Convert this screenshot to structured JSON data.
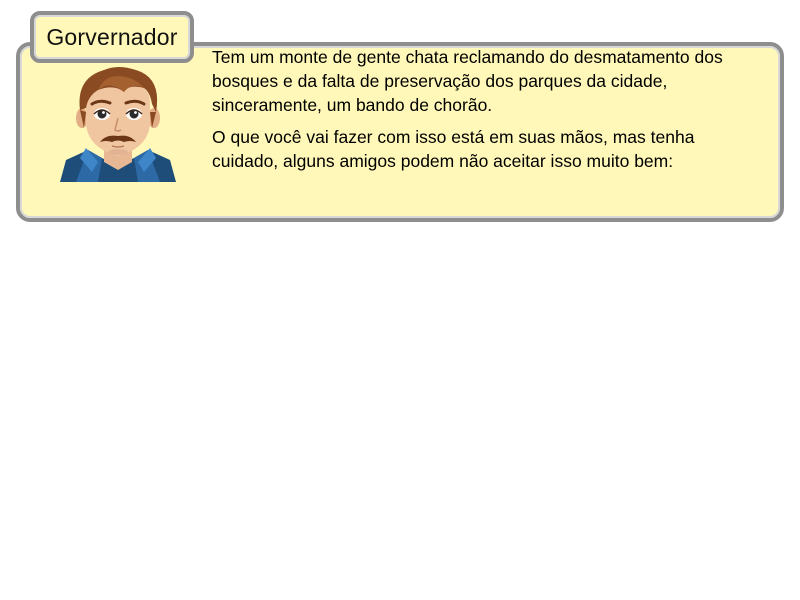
{
  "dialog": {
    "speaker_name": "Gorvernador",
    "portrait_icon": "governor-portrait-icon",
    "paragraphs": [
      "Tem um monte de gente chata reclamando do desmatamento dos bosques e da falta de preservação dos parques da cidade, sinceramente, um bando de chorão.",
      "O que você vai fazer com isso está em suas mãos, mas tenha cuidado, alguns amigos podem não aceitar isso muito bem:"
    ]
  },
  "colors": {
    "box_fill": "#fff8b8",
    "box_border": "#8e8e8e",
    "background": "#ffffff"
  }
}
